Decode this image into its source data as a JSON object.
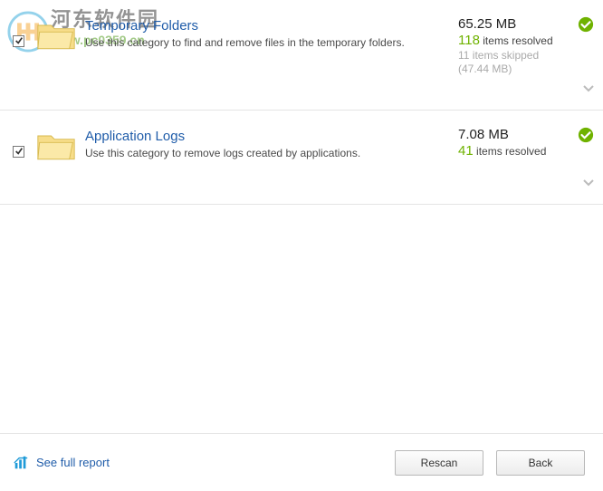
{
  "categories": [
    {
      "title": "Temporary Folders",
      "description": "Use this category to find and remove files in the temporary folders.",
      "checked": true,
      "size": "65.25 MB",
      "count": "118",
      "count_suffix": "items resolved",
      "skipped_line1": "11 items skipped",
      "skipped_line2": "(47.44 MB)"
    },
    {
      "title": "Application Logs",
      "description": "Use this category to remove logs created by applications.",
      "checked": true,
      "size": "7.08 MB",
      "count": "41",
      "count_suffix": "items resolved",
      "skipped_line1": "",
      "skipped_line2": ""
    }
  ],
  "footer": {
    "report_link": "See full report",
    "rescan": "Rescan",
    "back": "Back"
  },
  "watermark": {
    "title": "河东软件园",
    "sub": "www.pc0359.cn"
  }
}
